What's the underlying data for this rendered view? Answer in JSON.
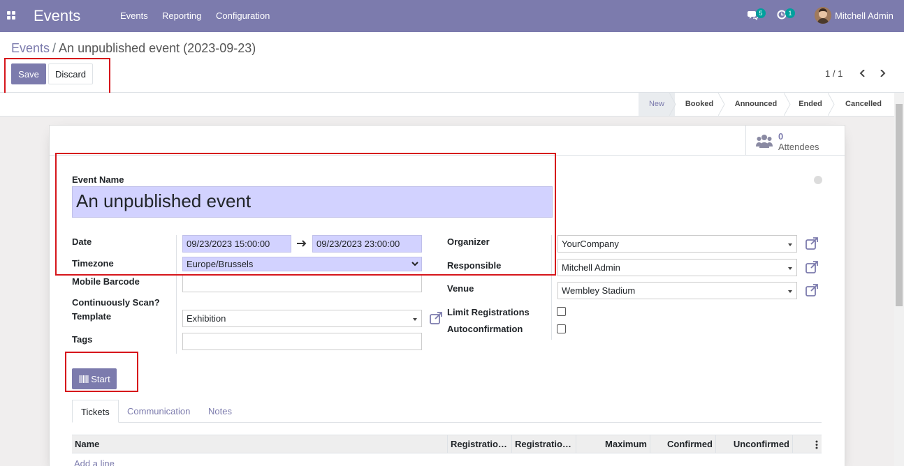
{
  "navbar": {
    "app_title": "Events",
    "menu": [
      "Events",
      "Reporting",
      "Configuration"
    ],
    "messages_count": "5",
    "activities_count": "1",
    "user_name": "Mitchell Admin",
    "accent": "#7c7bad"
  },
  "breadcrumb": {
    "parent": "Events",
    "separator": "/",
    "current": "An unpublished event (2023-09-23)"
  },
  "actions": {
    "save": "Save",
    "discard": "Discard"
  },
  "pager": {
    "value": "1 / 1"
  },
  "stages": [
    "New",
    "Booked",
    "Announced",
    "Ended",
    "Cancelled"
  ],
  "active_stage": "New",
  "attendees": {
    "count": "0",
    "label": "Attendees"
  },
  "form": {
    "event_name_label": "Event Name",
    "event_name": "An unpublished event",
    "date_label": "Date",
    "date_begin": "09/23/2023 15:00:00",
    "date_end": "09/23/2023 23:00:00",
    "timezone_label": "Timezone",
    "timezone": "Europe/Brussels",
    "mobile_barcode_label": "Mobile Barcode",
    "mobile_barcode": "",
    "continuous_scan_label": "Continuously Scan?",
    "template_label": "Template",
    "template": "Exhibition",
    "tags_label": "Tags",
    "tags": "",
    "organizer_label": "Organizer",
    "organizer": "YourCompany",
    "responsible_label": "Responsible",
    "responsible": "Mitchell Admin",
    "venue_label": "Venue",
    "venue": "Wembley Stadium",
    "limit_registrations_label": "Limit Registrations",
    "autoconfirmation_label": "Autoconfirmation",
    "start_button": "Start"
  },
  "tabs": [
    "Tickets",
    "Communication",
    "Notes"
  ],
  "table": {
    "columns": [
      "Name",
      "Registratio…",
      "Registratio…",
      "Maximum",
      "Confirmed",
      "Unconfirmed"
    ],
    "add_line": "Add a line"
  }
}
